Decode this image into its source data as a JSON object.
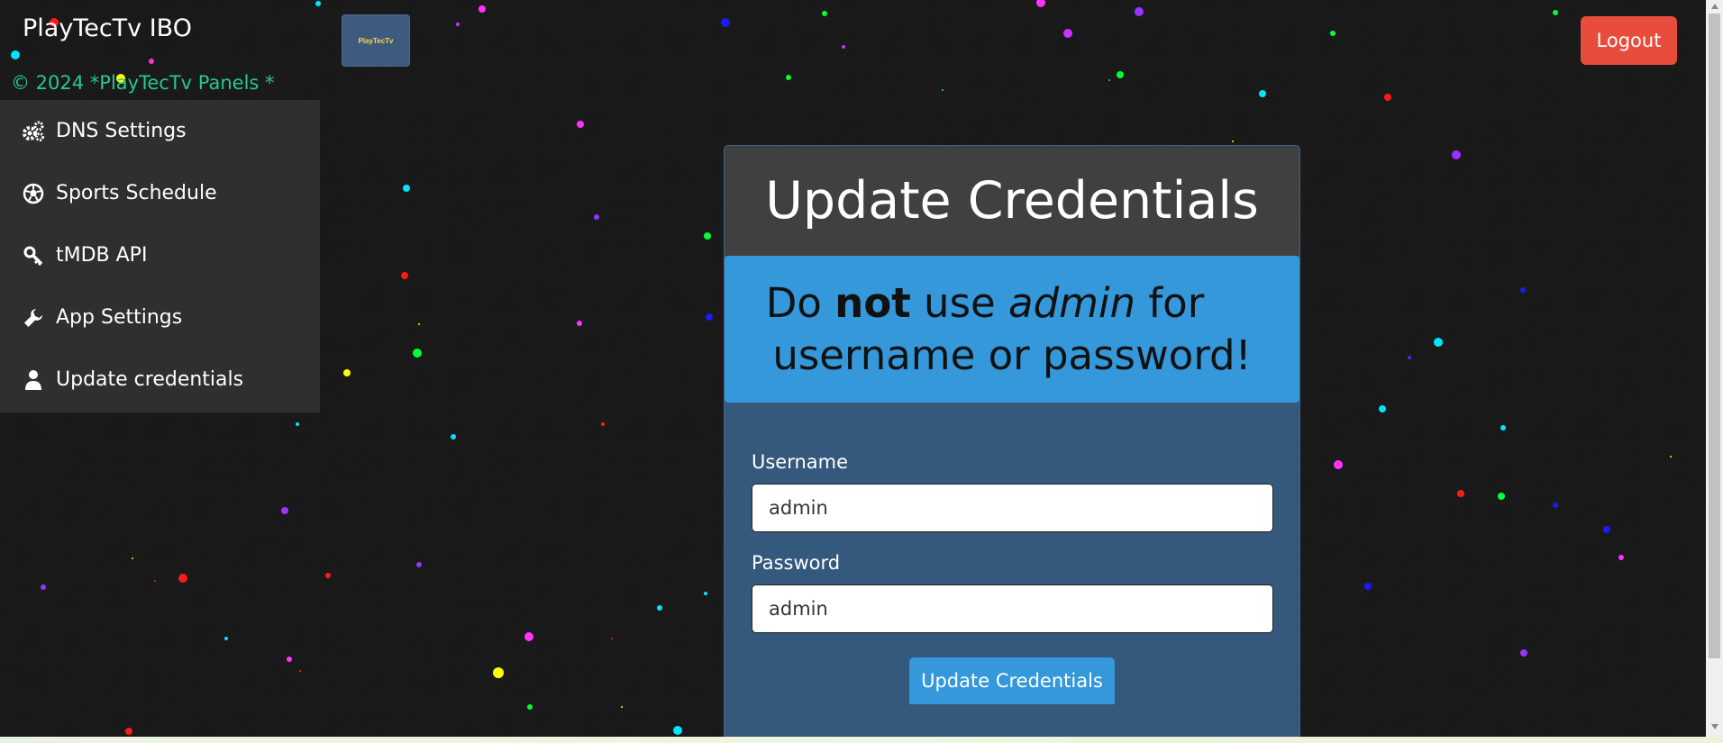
{
  "header": {
    "brand": "PlayTecTv IBO",
    "logo_text": "PlayTecTv",
    "copyright": "© 2024 *PlayTecTv Panels *",
    "logout_label": "Logout"
  },
  "sidebar": {
    "items": [
      {
        "label": "DNS Settings",
        "icon": "gears-icon"
      },
      {
        "label": "Sports Schedule",
        "icon": "soccer-ball-icon"
      },
      {
        "label": "tMDB API",
        "icon": "key-icon"
      },
      {
        "label": "App Settings",
        "icon": "wrench-icon"
      },
      {
        "label": "Update credentials",
        "icon": "user-icon"
      }
    ]
  },
  "panel": {
    "title": "Update Credentials",
    "warning": {
      "p1": "Do ",
      "bold": "not",
      "p2": " use ",
      "em": "admin",
      "p3": " for",
      "line2": "username or password!"
    },
    "username_label": "Username",
    "username_value": "admin",
    "password_label": "Password",
    "password_value": "admin",
    "submit_label": "Update Credentials"
  },
  "colors": {
    "logout": "#e74c3c",
    "accent": "#3498db",
    "panel": "#34597d",
    "copyright": "#27c98a"
  }
}
